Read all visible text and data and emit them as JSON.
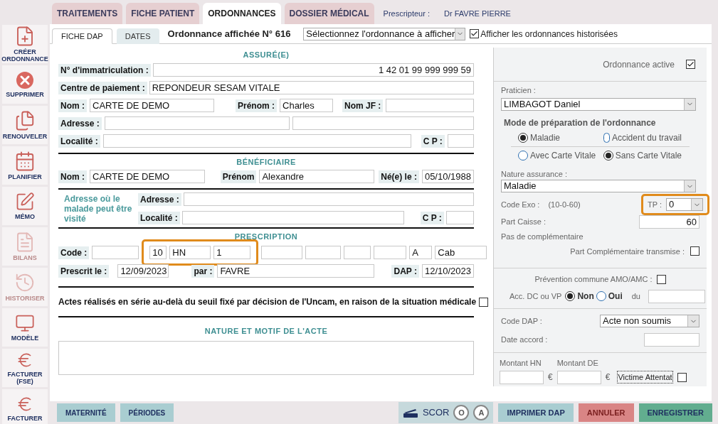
{
  "header": {
    "prescriber_label": "Prescripteur :",
    "prescriber": "Dr FAVRE PIERRE"
  },
  "tabs": [
    {
      "label": "TRAITEMENTS",
      "selected": false
    },
    {
      "label": "FICHE PATIENT",
      "selected": false
    },
    {
      "label": "ORDONNANCES",
      "selected": true
    },
    {
      "label": "DOSSIER MÉDICAL",
      "selected": false
    }
  ],
  "sidebar": [
    {
      "label": "CRÉER ORDONNANCE",
      "kind": "create",
      "disabled": false
    },
    {
      "label": "SUPPRIMER",
      "kind": "delete",
      "disabled": false
    },
    {
      "label": "RENOUVELER",
      "kind": "renew",
      "disabled": false
    },
    {
      "label": "PLANIFIER",
      "kind": "plan",
      "disabled": false
    },
    {
      "label": "MÉMO",
      "kind": "memo",
      "disabled": false
    },
    {
      "label": "BILANS",
      "kind": "report",
      "disabled": true
    },
    {
      "label": "HISTORISER",
      "kind": "history",
      "disabled": true
    },
    {
      "label": "MODÈLE",
      "kind": "model",
      "disabled": false
    },
    {
      "label": "FACTURER (FSE)",
      "kind": "fse",
      "disabled": false
    },
    {
      "label": "FACTURER",
      "kind": "paper",
      "disabled": false
    }
  ],
  "subtabs": [
    {
      "label": "FICHE DAP",
      "selected": true
    },
    {
      "label": "DATES",
      "selected": false
    }
  ],
  "ordonnance_title": "Ordonnance affichée N° 616",
  "ordonnance_select": "Sélectionnez l'ordonnance à afficher",
  "show_history": {
    "label": "Afficher les ordonnances historisées",
    "checked": true
  },
  "assure": {
    "title": "ASSURÉ(E)",
    "immatriculation": {
      "label": "N° d'immatriculation :",
      "value": "1 42 01 99 999 999 59"
    },
    "centre": {
      "label": "Centre de paiement :",
      "value": "REPONDEUR SESAM VITALE"
    },
    "nom": {
      "label": "Nom :",
      "value": "CARTE DE DEMO"
    },
    "prenom": {
      "label": "Prénom :",
      "value": "Charles"
    },
    "nom_jf": {
      "label": "Nom JF :"
    },
    "adresse": {
      "label": "Adresse :"
    },
    "localite": {
      "label": "Localité :"
    },
    "cp": {
      "label": "C P :"
    }
  },
  "beneficiaire": {
    "title": "BÉNÉFICIAIRE",
    "nom": {
      "label": "Nom :",
      "value": "CARTE DE DEMO"
    },
    "prenom": {
      "label": "Prénom",
      "value": "Alexandre"
    },
    "naissance": {
      "label": "Né(e) le :",
      "value": "05/10/1988"
    }
  },
  "visit_address": {
    "note": "Adresse où le malade peut être visité",
    "adresse": {
      "label": "Adresse :"
    },
    "localite": {
      "label": "Localité :"
    },
    "cp": {
      "label": "C P :"
    }
  },
  "prescription": {
    "title": "PRESCRIPTION",
    "code_label": "Code :",
    "code_cells": [
      {
        "highlighted": false
      },
      {
        "value": "10",
        "highlighted": true
      },
      {
        "value": "HN",
        "highlighted": true
      },
      {
        "value": "1",
        "highlighted": true
      },
      {
        "highlighted": false
      },
      {
        "highlighted": false
      },
      {
        "highlighted": false
      },
      {
        "highlighted": false
      },
      {
        "value": "A",
        "highlighted": false
      },
      {
        "value": "Cab",
        "highlighted": false
      }
    ],
    "prescrit": {
      "label": "Prescrit le :",
      "value": "12/09/2023"
    },
    "par": {
      "label": "par :",
      "value": "FAVRE"
    },
    "dap": {
      "label": "DAP :",
      "value": "12/10/2023"
    }
  },
  "serie": {
    "label": "Actes réalisés en série au-delà du seuil fixé par décision de l'Uncam, en raison de la situation médicale",
    "checked": false
  },
  "nature": {
    "title": "NATURE ET MOTIF DE L'ACTE"
  },
  "right": {
    "active": {
      "label": "Ordonnance active",
      "checked": true
    },
    "praticien": {
      "label": "Praticien :",
      "value": "LIMBAGOT Daniel"
    },
    "mode_title": "Mode de préparation de l'ordonnance",
    "mode_groups": [
      {
        "options": [
          {
            "label": "Maladie",
            "selected": true
          },
          {
            "label": "Accident du travail",
            "selected": false
          }
        ]
      },
      {
        "options": [
          {
            "label": "Avec Carte Vitale",
            "selected": false
          },
          {
            "label": "Sans Carte Vitale",
            "selected": true
          }
        ]
      }
    ],
    "nature_assurance": {
      "label": "Nature assurance :",
      "value": "Maladie"
    },
    "code_exo": {
      "label": "Code Exo :",
      "value": "(10-0-60)"
    },
    "tp": {
      "label": "TP :",
      "value": "0",
      "highlighted": true
    },
    "part_caisse": {
      "label": "Part Caisse :",
      "value": "60"
    },
    "complementaire": "Pas de complémentaire",
    "part_comp": {
      "label": "Part Complémentaire transmise :",
      "checked": false
    },
    "prevention": {
      "label": "Prévention commune AMO/AMC :",
      "checked": false
    },
    "acc": {
      "label": "Acc. DC ou VP",
      "options": [
        {
          "label": "Non",
          "selected": true
        },
        {
          "label": "Oui",
          "selected": false
        }
      ],
      "du_label": "du"
    },
    "code_dap": {
      "label": "Code DAP :",
      "value": "Acte non soumis"
    },
    "date_accord": {
      "label": "Date accord :"
    },
    "montant_hn": {
      "label": "Montant HN",
      "unit": "€"
    },
    "montant_de": {
      "label": "Montant DE",
      "unit": "€"
    },
    "victime": {
      "label": "Victime Attentat",
      "checked": false
    }
  },
  "footer_left": [
    "MATERNITÉ",
    "PÉRIODES"
  ],
  "scor": {
    "label": "SCOR",
    "badges": [
      "O",
      "A"
    ]
  },
  "footer_right": [
    {
      "label": "IMPRIMER DAP",
      "kind": "neutral"
    },
    {
      "label": "ANNULER",
      "kind": "danger"
    },
    {
      "label": "ENREGISTRER",
      "kind": "primary"
    }
  ]
}
